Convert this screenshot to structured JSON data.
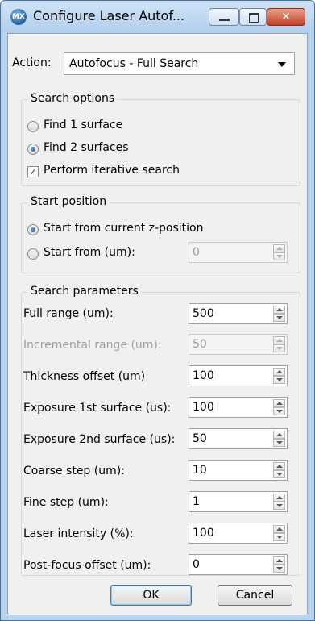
{
  "window": {
    "title": "Configure Laser Autof...",
    "app_icon_text": "MX"
  },
  "action": {
    "label": "Action:",
    "selected": "Autofocus - Full Search"
  },
  "search_options": {
    "title": "Search options",
    "find1": {
      "label": "Find 1 surface",
      "checked": false
    },
    "find2": {
      "label": "Find 2 surfaces",
      "checked": true
    },
    "iterative": {
      "label": "Perform iterative search",
      "checked": true
    }
  },
  "start_position": {
    "title": "Start position",
    "current": {
      "label": "Start from current z-position",
      "checked": true
    },
    "from": {
      "label": "Start from (um):",
      "value": "0",
      "checked": false
    }
  },
  "search_parameters": {
    "title": "Search parameters",
    "rows": [
      {
        "label": "Full range (um):",
        "value": "500",
        "enabled": true
      },
      {
        "label": "Incremental range (um):",
        "value": "50",
        "enabled": false
      },
      {
        "label": "Thickness offset (um)",
        "value": "100",
        "enabled": true
      },
      {
        "label": "Exposure 1st surface (us):",
        "value": "100",
        "enabled": true
      },
      {
        "label": "Exposure 2nd surface (us):",
        "value": "50",
        "enabled": true
      },
      {
        "label": "Coarse step (um):",
        "value": "10",
        "enabled": true
      },
      {
        "label": "Fine step (um):",
        "value": "1",
        "enabled": true
      },
      {
        "label": "Laser intensity (%):",
        "value": "100",
        "enabled": true
      },
      {
        "label": "Post-focus offset (um):",
        "value": "0",
        "enabled": true
      }
    ]
  },
  "buttons": {
    "ok": "OK",
    "cancel": "Cancel"
  }
}
